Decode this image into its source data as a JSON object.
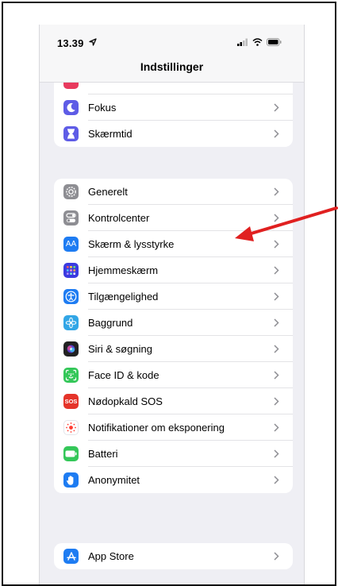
{
  "status_bar": {
    "time": "13.39"
  },
  "nav": {
    "title": "Indstillinger"
  },
  "groups": [
    {
      "rows": [
        {
          "label": "Fokus",
          "icon": "moon-icon",
          "color": "#5e5ce6"
        },
        {
          "label": "Skærmtid",
          "icon": "hourglass-icon",
          "color": "#5e5ce6"
        }
      ]
    },
    {
      "rows": [
        {
          "label": "Generelt",
          "icon": "gear-icon",
          "color": "#8e8e93"
        },
        {
          "label": "Kontrolcenter",
          "icon": "toggles-icon",
          "color": "#8e8e93"
        },
        {
          "label": "Skærm & lysstyrke",
          "icon": "text-size-icon",
          "color": "#1e7cf2"
        },
        {
          "label": "Hjemmeskærm",
          "icon": "app-grid-icon",
          "color": "#3b3be0"
        },
        {
          "label": "Tilgængelighed",
          "icon": "accessibility-icon",
          "color": "#1e7cf2"
        },
        {
          "label": "Baggrund",
          "icon": "flower-icon",
          "color": "#32a6e6"
        },
        {
          "label": "Siri & søgning",
          "icon": "siri-icon",
          "color": "#222222"
        },
        {
          "label": "Face ID & kode",
          "icon": "face-id-icon",
          "color": "#34c759"
        },
        {
          "label": "Nødopkald SOS",
          "icon": "sos-icon",
          "color": "#e5342a"
        },
        {
          "label": "Notifikationer om eksponering",
          "icon": "exposure-icon",
          "color": "#ffffff"
        },
        {
          "label": "Batteri",
          "icon": "battery-icon",
          "color": "#34c759"
        },
        {
          "label": "Anonymitet",
          "icon": "hand-icon",
          "color": "#1e7cf2"
        }
      ]
    },
    {
      "rows": [
        {
          "label": "App Store",
          "icon": "app-store-icon",
          "color": "#1e7cf2"
        }
      ]
    }
  ],
  "sos_icon_text": "SOS",
  "text_size_icon_text": "AA",
  "annotation": {
    "color": "#e02020"
  }
}
